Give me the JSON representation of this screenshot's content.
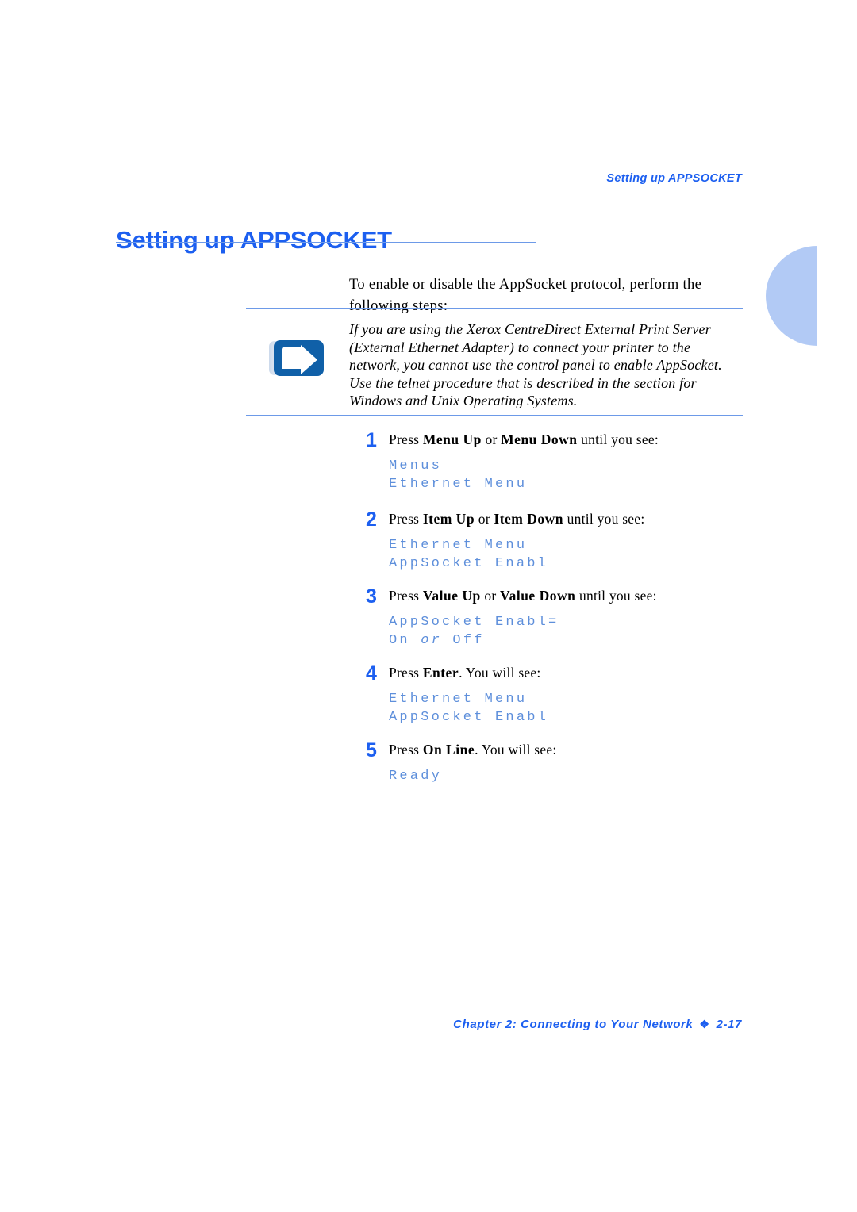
{
  "running_header": "Setting up APPSOCKET",
  "title": "Setting up APPSOCKET",
  "intro": "To enable or disable the AppSocket protocol, perform the following steps:",
  "note": {
    "icon": "blue-arrow-note-icon",
    "lines": [
      "If you are using the Xerox CentreDirect External Print Server",
      "(External Ethernet Adapter) to connect your printer to the",
      "network, you cannot use the control panel to enable AppSocket.",
      "Use the telnet procedure that is described in the section for",
      "Windows and Unix Operating Systems."
    ]
  },
  "steps": [
    {
      "number": "1",
      "instruction_parts": [
        {
          "text": "Press ",
          "bold": false
        },
        {
          "text": "Menu Up",
          "bold": true
        },
        {
          "text": " or ",
          "bold": false
        },
        {
          "text": "Menu Down",
          "bold": true
        },
        {
          "text": " until you see:",
          "bold": false
        }
      ],
      "code_lines": [
        "Menus",
        "Ethernet Menu"
      ]
    },
    {
      "number": "2",
      "instruction_parts": [
        {
          "text": "Press ",
          "bold": false
        },
        {
          "text": "Item Up",
          "bold": true
        },
        {
          "text": " or ",
          "bold": false
        },
        {
          "text": "Item Down",
          "bold": true
        },
        {
          "text": " until you see:",
          "bold": false
        }
      ],
      "code_lines": [
        "Ethernet Menu",
        "AppSocket Enabl"
      ]
    },
    {
      "number": "3",
      "instruction_parts": [
        {
          "text": "Press ",
          "bold": false
        },
        {
          "text": "Value Up",
          "bold": true
        },
        {
          "text": " or ",
          "bold": false
        },
        {
          "text": "Value Down",
          "bold": true
        },
        {
          "text": " until you see:",
          "bold": false
        }
      ],
      "code_lines": [
        "AppSocket Enabl=",
        "On or Off"
      ],
      "code_italic_word": "or"
    },
    {
      "number": "4",
      "instruction_parts": [
        {
          "text": "Press ",
          "bold": false
        },
        {
          "text": "Enter",
          "bold": true
        },
        {
          "text": ". You will see:",
          "bold": false
        }
      ],
      "code_lines": [
        "Ethernet Menu",
        "AppSocket Enabl"
      ]
    },
    {
      "number": "5",
      "instruction_parts": [
        {
          "text": "Press ",
          "bold": false
        },
        {
          "text": "On Line",
          "bold": true
        },
        {
          "text": ". You will see:",
          "bold": false
        }
      ],
      "code_lines": [
        "Ready"
      ]
    }
  ],
  "footer": {
    "chapter": "Chapter 2: Connecting to Your Network",
    "separator": "❖",
    "page_number": "2-17"
  },
  "colors": {
    "accent_blue": "#1c5ff0",
    "rule_blue": "#6d9ae8",
    "code_blue": "#5e8fdb",
    "tab_blue": "#b2caf5",
    "icon_blue": "#1060a8"
  }
}
